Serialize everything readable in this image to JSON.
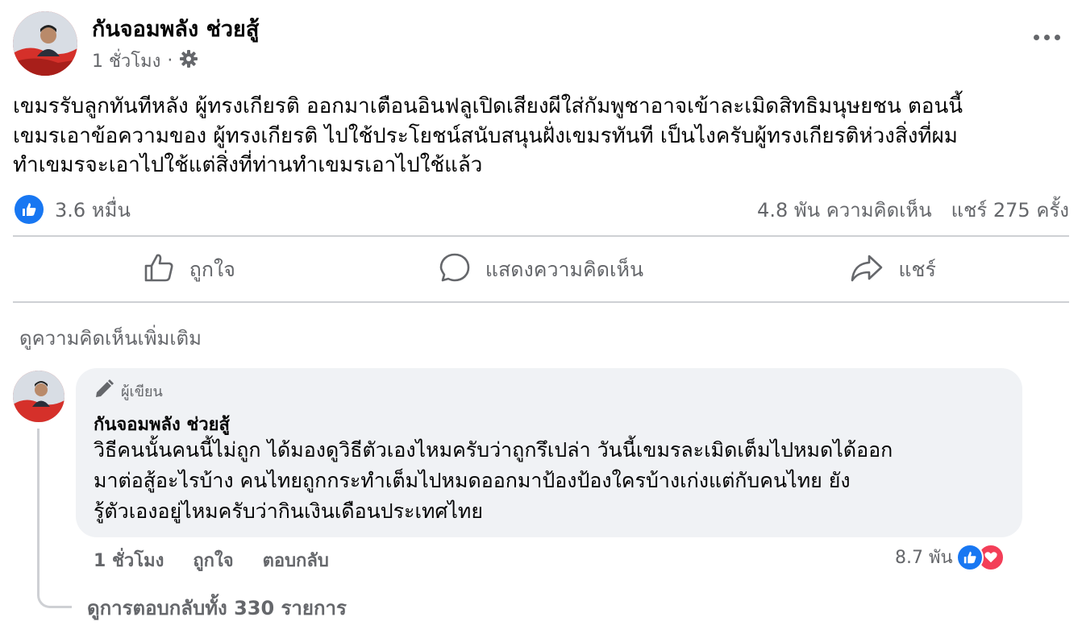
{
  "post": {
    "author": "กันจอมพลัง ช่วยสู้",
    "time": "1 ชั่วโมง",
    "separator": "·",
    "privacy_icon": "gear-icon",
    "more_icon": "more-dots-icon",
    "text_lines": [
      "เขมรรับลูกทันทีหลัง ผู้ทรงเกียรติ ออกมาเตือนอินฟลูเปิดเสียงผีใส่กัมพูชาอาจเข้าละเมิดสิทธิมนุษยชน ตอนนี้",
      "เขมรเอาข้อความของ ผู้ทรงเกียรติ ไปใช้ประโยชน์สนับสนุนฝั่งเขมรทันที เป็นไงครับผู้ทรงเกียรติห่วงสิ่งที่ผม",
      "ทำเขมรจะเอาไปใช้แต่สิ่งที่ท่านทำเขมรเอาไปใช้แล้ว"
    ],
    "reactions_count": "3.6 หมื่น",
    "comments_count": "4.8 พัน ความคิดเห็น",
    "shares_count": "แชร์ 275 ครั้ง"
  },
  "actions": {
    "like": "ถูกใจ",
    "comment": "แสดงความคิดเห็น",
    "share": "แชร์"
  },
  "more_comments": "ดูความคิดเห็นเพิ่มเติม",
  "comment": {
    "badge": "ผู้เขียน",
    "author": "กันจอมพลัง ช่วยสู้",
    "text_lines": [
      "วิธีคนนั้นคนนี้ไม่ถูก ได้มองดูวิธีตัวเองไหมครับว่าถูกรึเปล่า วันนี้เขมรละเมิดเต็มไปหมดได้ออก",
      "มาต่อสู้อะไรบ้าง คนไทยถูกกระทำเต็มไปหมดออกมาป้องป้องใครบ้างเก่งแต่กับคนไทย ยัง",
      "รู้ตัวเองอยู่ไหมครับว่ากินเงินเดือนประเทศไทย"
    ],
    "time": "1 ชั่วโมง",
    "like": "ถูกใจ",
    "reply": "ตอบกลับ",
    "reactions_count": "8.7 พัน",
    "view_replies": "ดูการตอบกลับทั้ง 330 รายการ"
  },
  "colors": {
    "facebook_blue": "#1877f2",
    "love_red": "#f33e58",
    "secondary_text": "#65676b",
    "bubble_bg": "#f0f2f5"
  }
}
